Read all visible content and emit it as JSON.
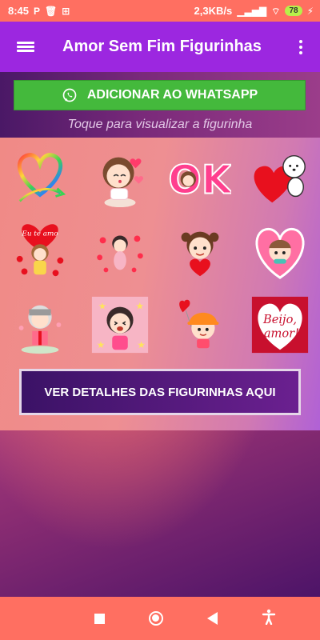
{
  "status_bar": {
    "time": "8:45",
    "left_glyphs": [
      "P",
      "🗑",
      "⊞"
    ],
    "speed": "2,3KB/s",
    "signal": "▁▃▅▇",
    "wifi": "⌔",
    "battery": "78",
    "charging": "⚡"
  },
  "app_bar": {
    "title": "Amor Sem Fim Figurinhas",
    "bg_color": "#9c27e0"
  },
  "whatsapp_button": {
    "label": "ADICIONAR AO WHATSAPP",
    "color": "#44b93c"
  },
  "hint": "Toque para visualizar a figurinha",
  "stickers": [
    {
      "name": "rainbow-heart-sticker"
    },
    {
      "name": "girl-kissing-hearts-sticker"
    },
    {
      "name": "ok-girl-sticker"
    },
    {
      "name": "white-bear-heart-sticker"
    },
    {
      "name": "eu-te-amo-girl-sticker"
    },
    {
      "name": "baby-hearts-sticker"
    },
    {
      "name": "girl-holding-heart-sticker"
    },
    {
      "name": "boy-in-heart-sticker"
    },
    {
      "name": "girl-gift-sticker"
    },
    {
      "name": "happy-girl-stars-sticker"
    },
    {
      "name": "girl-hat-balloon-sticker"
    },
    {
      "name": "beijo-amor-card-sticker"
    }
  ],
  "sticker_texts": {
    "ok": "OK",
    "eu_te_amo": "Eu te amo",
    "beijo": "Beijo,",
    "amor": "amor!"
  },
  "details_button": {
    "label": "VER DETALHES DAS FIGURINHAS AQUI"
  },
  "nav_bar": {
    "icons": [
      "recent-apps-icon",
      "home-icon",
      "back-icon",
      "accessibility-icon"
    ],
    "color": "#ff6f61"
  }
}
